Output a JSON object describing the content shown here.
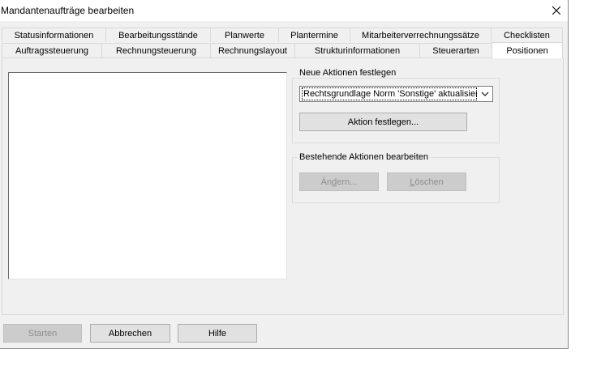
{
  "window": {
    "title": "Mandantenaufträge bearbeiten"
  },
  "tabs": {
    "row1": [
      "Statusinformationen",
      "Bearbeitungsstände",
      "Planwerte",
      "Plantermine",
      "Mitarbeiterverrechnungssätze",
      "Checklisten"
    ],
    "row2": [
      "Auftragssteuerung",
      "Rechnungsteuerung",
      "Rechnungslayout",
      "Strukturinformationen",
      "Steuerarten",
      "Positionen"
    ],
    "active": "Positionen"
  },
  "new_actions": {
    "legend": "Neue Aktionen festlegen",
    "select_value": "Rechtsgrundlage Norm 'Sonstige' aktualisieren",
    "set_button": "Aktion festlegen..."
  },
  "existing_actions": {
    "legend": "Bestehende Aktionen bearbeiten",
    "edit_button_pre": "Än",
    "edit_button_u": "d",
    "edit_button_post": "ern...",
    "delete_button_pre": "",
    "delete_button_u": "L",
    "delete_button_post": "öschen"
  },
  "footer": {
    "start": "Starten",
    "cancel": "Abbrechen",
    "help": "Hilfe"
  },
  "icons": {
    "close": "close-icon",
    "dropdown": "chevron-down-icon"
  }
}
